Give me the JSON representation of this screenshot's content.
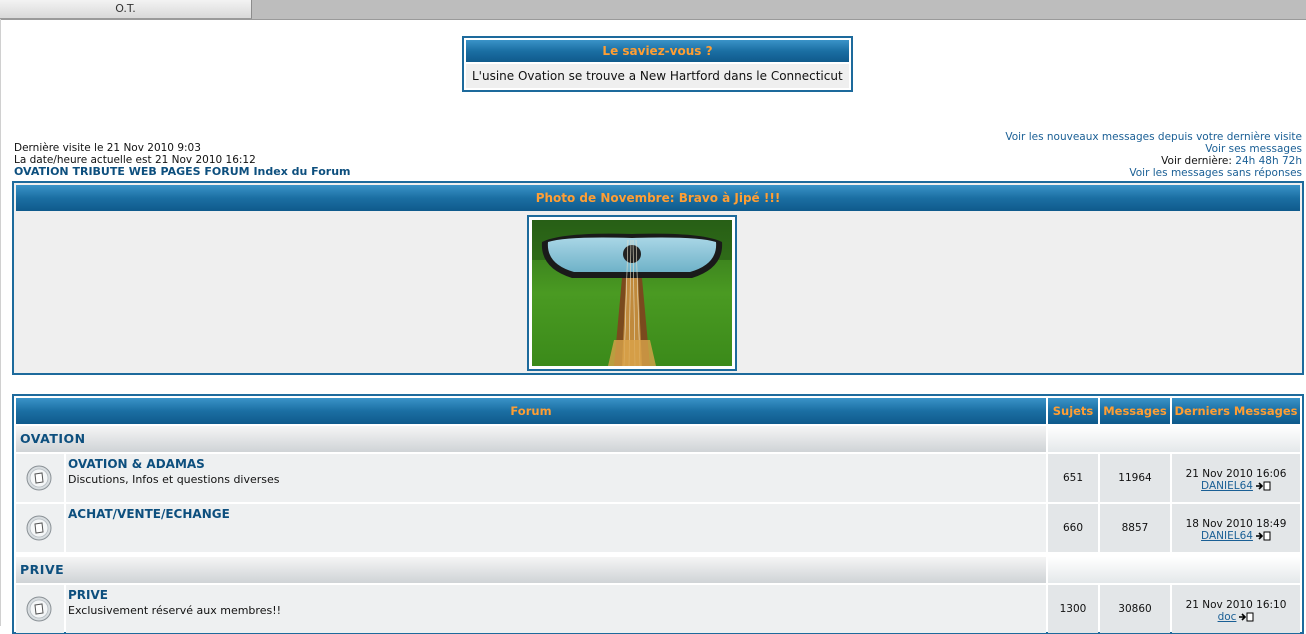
{
  "tab": {
    "label": "O.T."
  },
  "did_you_know": {
    "title": "Le saviez-vous ?",
    "text": "L'usine Ovation se trouve a New Hartford dans le Connecticut"
  },
  "visit": {
    "last_visit": "Dernière visite le 21 Nov 2010 9:03",
    "current_time": "La date/heure actuelle est 21 Nov 2010 16:12",
    "index_link": "OVATION TRIBUTE WEB PAGES FORUM Index du Forum"
  },
  "links": {
    "new_messages": "Voir les nouveaux messages depuis votre dernière visite",
    "my_messages": "Voir ses messages",
    "last_label": "Voir dernière:",
    "last_24h": "24h",
    "last_48h": "48h",
    "last_72h": "72h",
    "unanswered": "Voir les messages sans réponses"
  },
  "photo": {
    "title": "Photo de Novembre: Bravo à Jipé !!!"
  },
  "forum_table": {
    "headers": {
      "forum": "Forum",
      "topics": "Sujets",
      "messages": "Messages",
      "last": "Derniers Messages"
    },
    "categories": [
      {
        "name": "OVATION",
        "forums": [
          {
            "title": "OVATION & ADAMAS",
            "desc": "Discutions, Infos et questions diverses",
            "topics": "651",
            "messages": "11964",
            "last_date": "21 Nov 2010 16:06",
            "last_user": "DANIEL64"
          },
          {
            "title": "ACHAT/VENTE/ECHANGE",
            "desc": "",
            "topics": "660",
            "messages": "8857",
            "last_date": "18 Nov 2010 18:49",
            "last_user": "DANIEL64"
          }
        ]
      },
      {
        "name": "PRIVE",
        "forums": [
          {
            "title": "PRIVE",
            "desc": "Exclusivement réservé aux membres!!",
            "topics": "1300",
            "messages": "30860",
            "last_date": "21 Nov 2010 16:10",
            "last_user": "doc"
          }
        ]
      }
    ]
  },
  "colors": {
    "header_blue": "#1b6fa3",
    "header_text": "#ff9e33",
    "link_blue": "#1a5f95",
    "title_blue": "#0d4f7e"
  }
}
